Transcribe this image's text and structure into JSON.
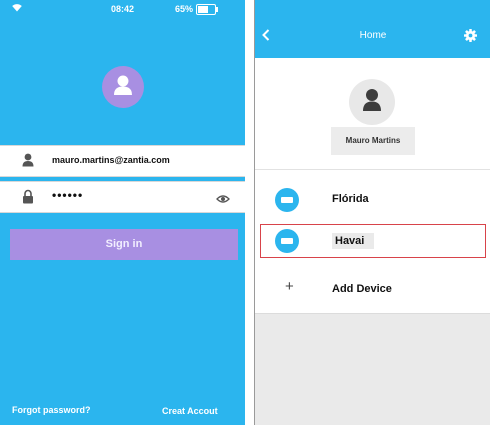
{
  "login_screen": {
    "status": {
      "time": "08:42",
      "battery": "65%"
    },
    "email": {
      "value": "mauro.martins@zantia.com"
    },
    "password": {
      "value": "••••••"
    },
    "signin_label": "Sign in",
    "forgot_label": "Forgot password?",
    "create_label": "Creat Accout"
  },
  "home_screen": {
    "title": "Home",
    "user_name": "Mauro Martins",
    "devices": [
      {
        "label": "Flórida"
      },
      {
        "label": "Havai"
      }
    ],
    "add_label": "Add Device"
  },
  "colors": {
    "accent": "#2bb5ee",
    "button": "#a88fe2",
    "highlight": "#d8434a"
  },
  "icons": [
    "wifi-icon",
    "battery-icon",
    "user-icon",
    "lock-icon",
    "eye-icon",
    "back-icon",
    "settings-icon",
    "ac-device-icon",
    "plus-icon"
  ]
}
